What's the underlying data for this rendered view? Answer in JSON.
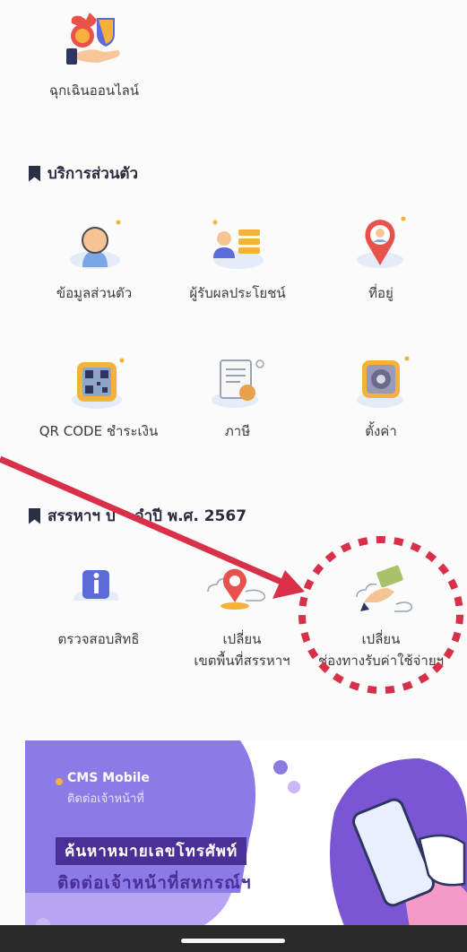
{
  "top_item": {
    "label": "ฉุกเฉินออนไลน์",
    "icon": "money-bag-hand-icon"
  },
  "sections": [
    {
      "title": "บริการส่วนตัว",
      "items": [
        {
          "label": "ข้อมูลส่วนตัว",
          "icon": "person-icon"
        },
        {
          "label": "ผู้รับผลประโยชน์",
          "icon": "beneficiary-icon"
        },
        {
          "label": "ที่อยู่",
          "icon": "location-pin-icon"
        },
        {
          "label": "QR CODE ชำระเงิน",
          "icon": "qr-code-icon"
        },
        {
          "label": "ภาษี",
          "icon": "tax-document-icon"
        },
        {
          "label": "ตั้งค่า",
          "icon": "settings-icon"
        }
      ]
    },
    {
      "title_part1": "สรรหาฯ ป",
      "title_part2": "จำปี พ.ศ. 2567",
      "items": [
        {
          "label": "ตรวจสอบสิทธิ",
          "icon": "info-icon"
        },
        {
          "label_line1": "เปลี่ยน",
          "label_line2": "เขตพื้นที่สรรหาฯ",
          "icon": "map-pin-cloud-icon"
        },
        {
          "label_line1": "เปลี่ยน",
          "label_line2": "ช่องทางรับค่าใช้จ่ายฯ",
          "icon": "money-hand-icon"
        }
      ]
    }
  ],
  "banner": {
    "brand": "CMS Mobile",
    "brand_sub": "ติดต่อเจ้าหน้าที่",
    "headline1": "ค้นหาหมายเลขโทรศัพท์",
    "headline2": "ติดต่อเจ้าหน้าที่สหกรณ์ฯ"
  },
  "annotation": {
    "arrow_color": "#d9304a",
    "circle_color": "#d9304a"
  }
}
